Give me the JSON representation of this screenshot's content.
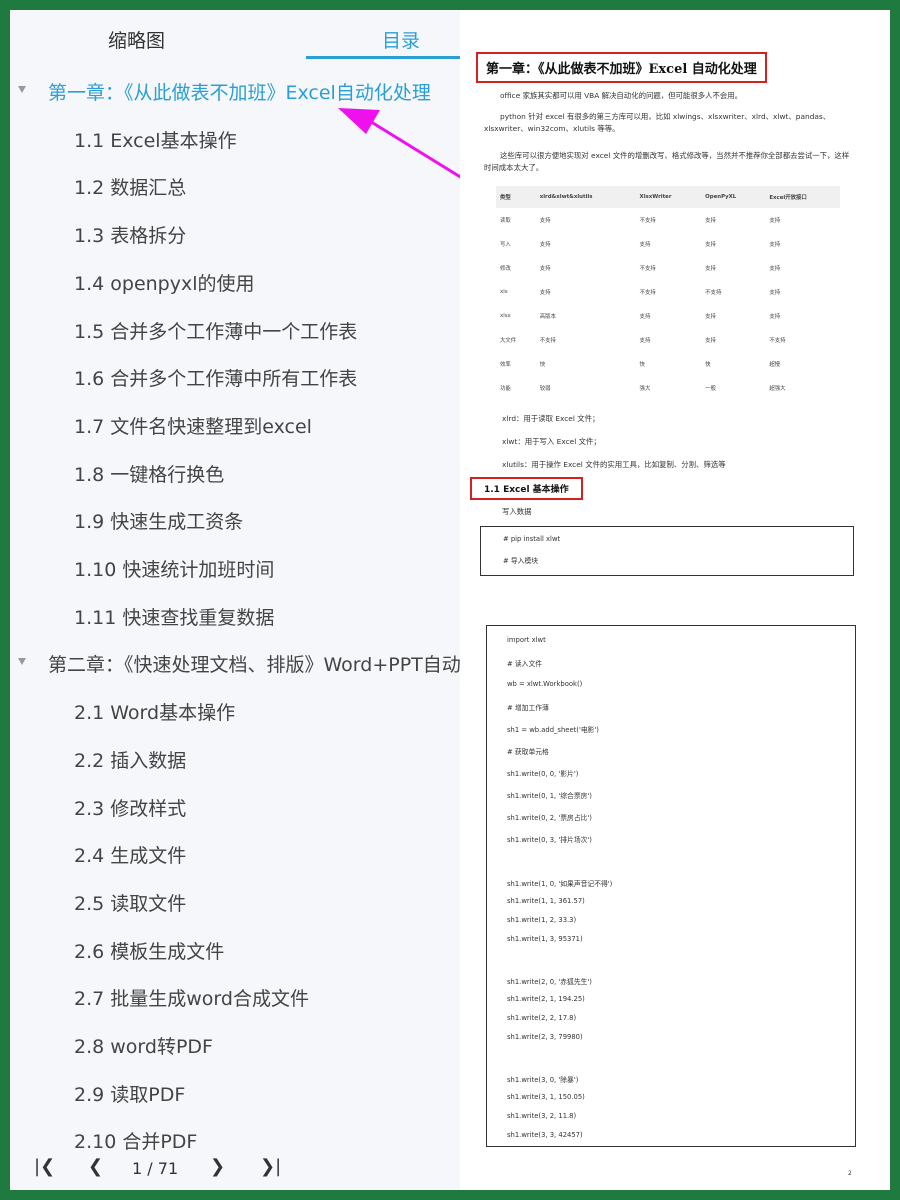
{
  "left_panel": {
    "tabs": {
      "thumbnail": "缩略图",
      "toc": "目录"
    },
    "toc": [
      {
        "label": "第一章：《从此做表不加班》Excel自动化处理",
        "type": "chapter",
        "active": true
      },
      {
        "label": "1.1 Excel基本操作",
        "type": "section"
      },
      {
        "label": "1.2 数据汇总",
        "type": "section"
      },
      {
        "label": "1.3 表格拆分",
        "type": "section"
      },
      {
        "label": "1.4 openpyxl的使用",
        "type": "section"
      },
      {
        "label": "1.5 合并多个工作薄中一个工作表",
        "type": "section"
      },
      {
        "label": "1.6 合并多个工作薄中所有工作表",
        "type": "section"
      },
      {
        "label": "1.7 文件名快速整理到excel",
        "type": "section"
      },
      {
        "label": "1.8 一键格行换色",
        "type": "section"
      },
      {
        "label": "1.9 快速生成工资条",
        "type": "section"
      },
      {
        "label": "1.10 快速统计加班时间",
        "type": "section"
      },
      {
        "label": "1.11 快速查找重复数据",
        "type": "section"
      },
      {
        "label": "第二章：《快速处理文档、排版》Word+PPT自动化",
        "type": "chapter"
      },
      {
        "label": "2.1 Word基本操作",
        "type": "section"
      },
      {
        "label": "2.2 插入数据",
        "type": "section"
      },
      {
        "label": "2.3 修改样式",
        "type": "section"
      },
      {
        "label": "2.4 生成文件",
        "type": "section"
      },
      {
        "label": "2.5 读取文件",
        "type": "section"
      },
      {
        "label": "2.6 模板生成文件",
        "type": "section"
      },
      {
        "label": "2.7 批量生成word合成文件",
        "type": "section"
      },
      {
        "label": "2.8 word转PDF",
        "type": "section"
      },
      {
        "label": "2.9 读取PDF",
        "type": "section"
      },
      {
        "label": "2.10 合并PDF",
        "type": "section"
      }
    ],
    "pager": {
      "first_icon": "first-page-icon",
      "prev_icon": "prev-page-icon",
      "next_icon": "next-page-icon",
      "last_icon": "last-page-icon",
      "current": "1",
      "total": "/ 71"
    }
  },
  "document": {
    "chapter_title": "第一章：《从此做表不加班》Excel 自动化处理",
    "paragraphs": [
      "office 家族其实都可以用 VBA 解决自动化的问题，但可能很多人不会用。",
      "python 针对 excel 有很多的第三方库可以用，比如 xlwings、xlsxwriter、xlrd、xlwt、pandas、xlsxwriter、win32com、xlutils 等等。",
      "这些库可以很方便地实现对 excel 文件的增删改写、格式修改等，当然并不推荐你全部都去尝试一下，这样时间成本太大了。"
    ],
    "table": {
      "headers": [
        "类型",
        "xlrd&xlwt&xlutils",
        "XlsxWriter",
        "OpenPyXL",
        "Excel开放接口"
      ],
      "rows": [
        [
          "读取",
          "支持",
          "不支持",
          "支持",
          "支持"
        ],
        [
          "写入",
          "支持",
          "支持",
          "支持",
          "支持"
        ],
        [
          "修改",
          "支持",
          "不支持",
          "支持",
          "支持"
        ],
        [
          "xls",
          "支持",
          "不支持",
          "不支持",
          "支持"
        ],
        [
          "xlsx",
          "高版本",
          "支持",
          "支持",
          "支持"
        ],
        [
          "大文件",
          "不支持",
          "支持",
          "支持",
          "不支持"
        ],
        [
          "效率",
          "快",
          "快",
          "快",
          "超慢"
        ],
        [
          "功能",
          "较弱",
          "强大",
          "一般",
          "超强大"
        ]
      ]
    },
    "notes": [
      "xlrd：用于读取 Excel 文件；",
      "xlwt：用于写入 Excel 文件；",
      "xlutils：用于操作 Excel 文件的实用工具，比如复制、分割、筛选等"
    ],
    "section_title": "1.1 Excel 基本操作",
    "write_label": "写入数据",
    "install_code": [
      "# pip install xlwt",
      "# 导入模块"
    ],
    "main_code": [
      "import xlwt",
      "# 读入文件",
      "wb = xlwt.Workbook()",
      "# 增加工作薄",
      "sh1 = wb.add_sheet('电影')",
      "# 获取单元格",
      "sh1.write(0, 0, '影片')",
      "sh1.write(0, 1, '综合票房')",
      "sh1.write(0, 2, '票房占比')",
      "sh1.write(0, 3, '排片场次')",
      "",
      "sh1.write(1, 0, '如果声音记不得')",
      "sh1.write(1, 1, 361.57)",
      "sh1.write(1, 2, 33.3)",
      "sh1.write(1, 3, 95371)",
      "",
      "sh1.write(2, 0, '赤狐先生')",
      "sh1.write(2, 1, 194.25)",
      "sh1.write(2, 2, 17.8)",
      "sh1.write(2, 3, 79980)",
      "",
      "sh1.write(3, 0, '除暴')",
      "sh1.write(3, 1, 150.05)",
      "sh1.write(3, 2, 11.8)",
      "sh1.write(3, 3, 42457)"
    ],
    "page_number": "2"
  },
  "colors": {
    "accent": "#2a9fd6",
    "arrow": "#ee11ee",
    "highlight_box": "#d62020",
    "border": "#1e7a3e"
  }
}
